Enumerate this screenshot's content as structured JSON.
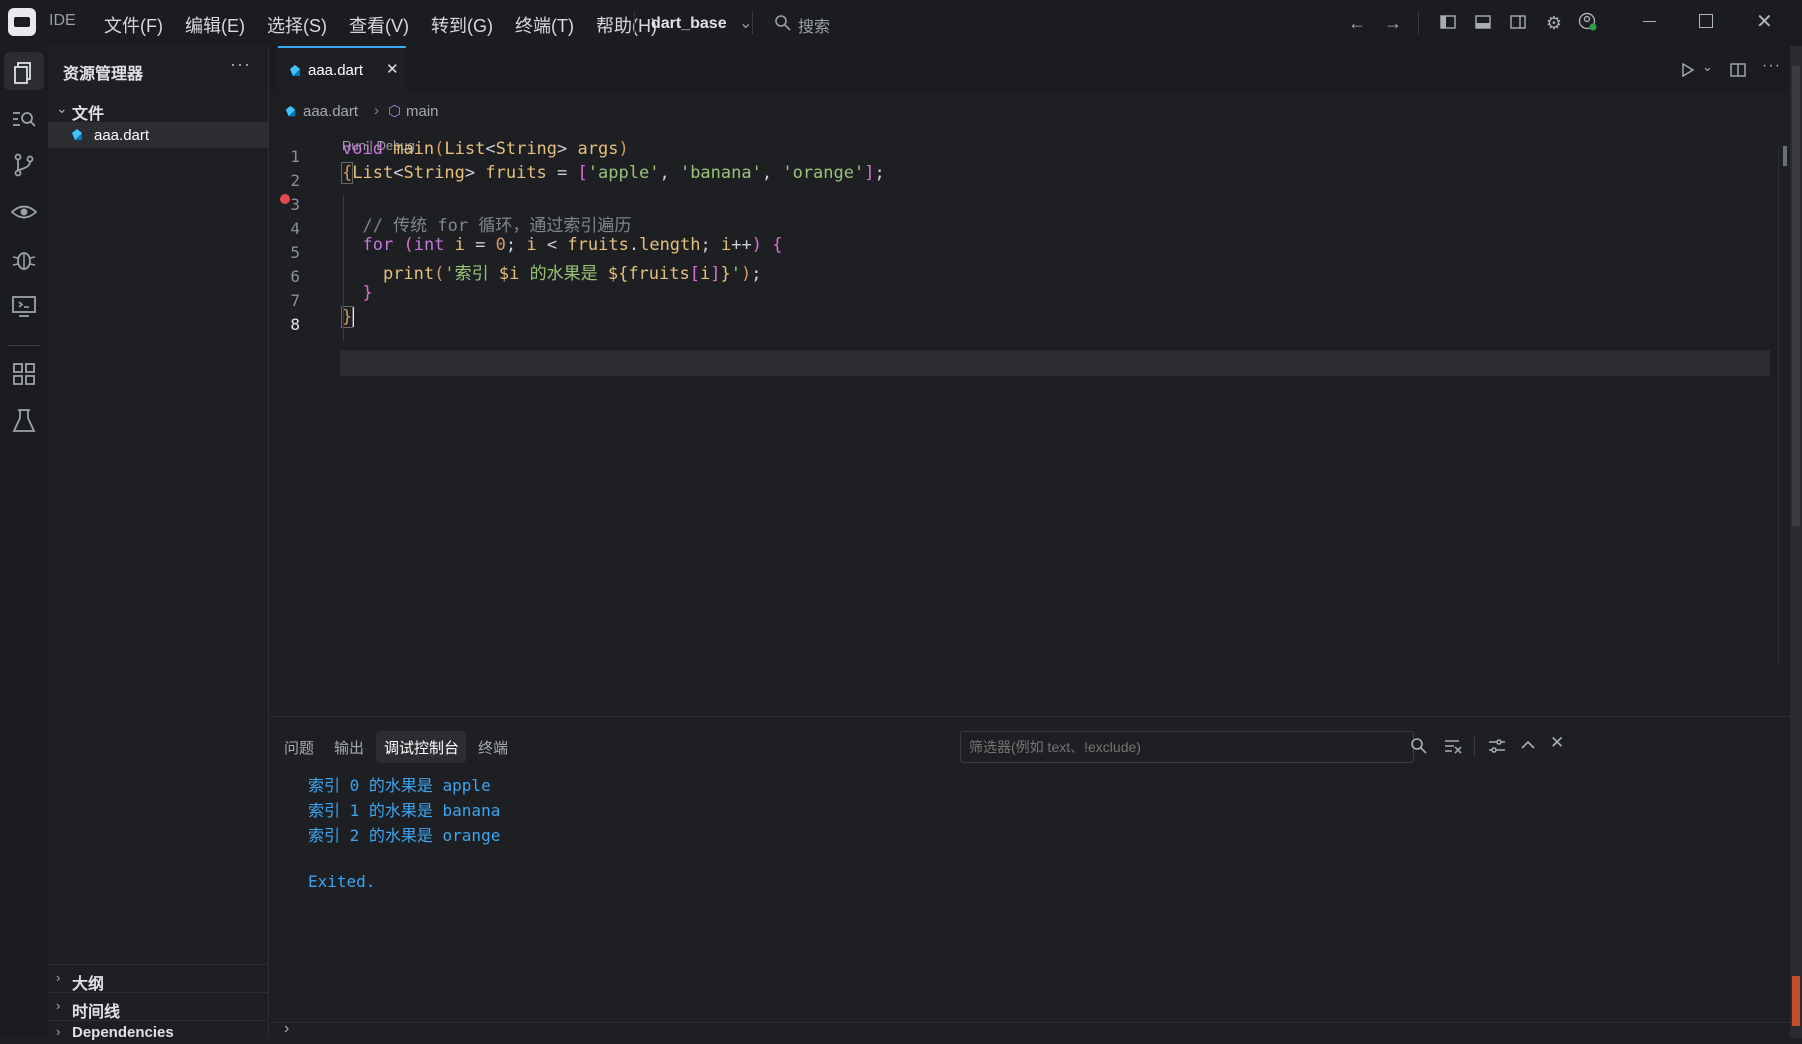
{
  "titlebar": {
    "app_name": "IDE",
    "menus": [
      "文件(F)",
      "编辑(E)",
      "选择(S)",
      "查看(V)",
      "转到(G)",
      "终端(T)",
      "帮助(H)"
    ],
    "workspace": "dart_base",
    "search_placeholder": "搜索"
  },
  "sidebar": {
    "title": "资源管理器",
    "folder": "文件",
    "file": "aaa.dart",
    "sections": [
      "大纲",
      "时间线",
      "Dependencies"
    ]
  },
  "editor": {
    "tab_label": "aaa.dart",
    "breadcrumb_file": "aaa.dart",
    "breadcrumb_symbol": "main",
    "codelens": "Run | Debug",
    "line_numbers": [
      "1",
      "2",
      "3",
      "4",
      "5",
      "6",
      "7",
      "8"
    ]
  },
  "panel": {
    "tabs": [
      "问题",
      "输出",
      "调试控制台",
      "终端"
    ],
    "active_tab": "调试控制台",
    "filter_placeholder": "筛选器(例如 text、!exclude)",
    "output_lines": [
      "索引 0 的水果是 apple",
      "索引 1 的水果是 banana",
      "索引 2 的水果是 orange",
      "",
      "Exited."
    ]
  },
  "colors": {
    "accent": "#3aa5f0",
    "breakpoint": "#e5484d",
    "background": "#1e1f22"
  },
  "icons": [
    "explorer-icon",
    "search-icon",
    "source-control-icon",
    "preview-icon",
    "debug-icon",
    "remote-icon",
    "extensions-icon",
    "testing-icon",
    "dart-file-icon"
  ]
}
